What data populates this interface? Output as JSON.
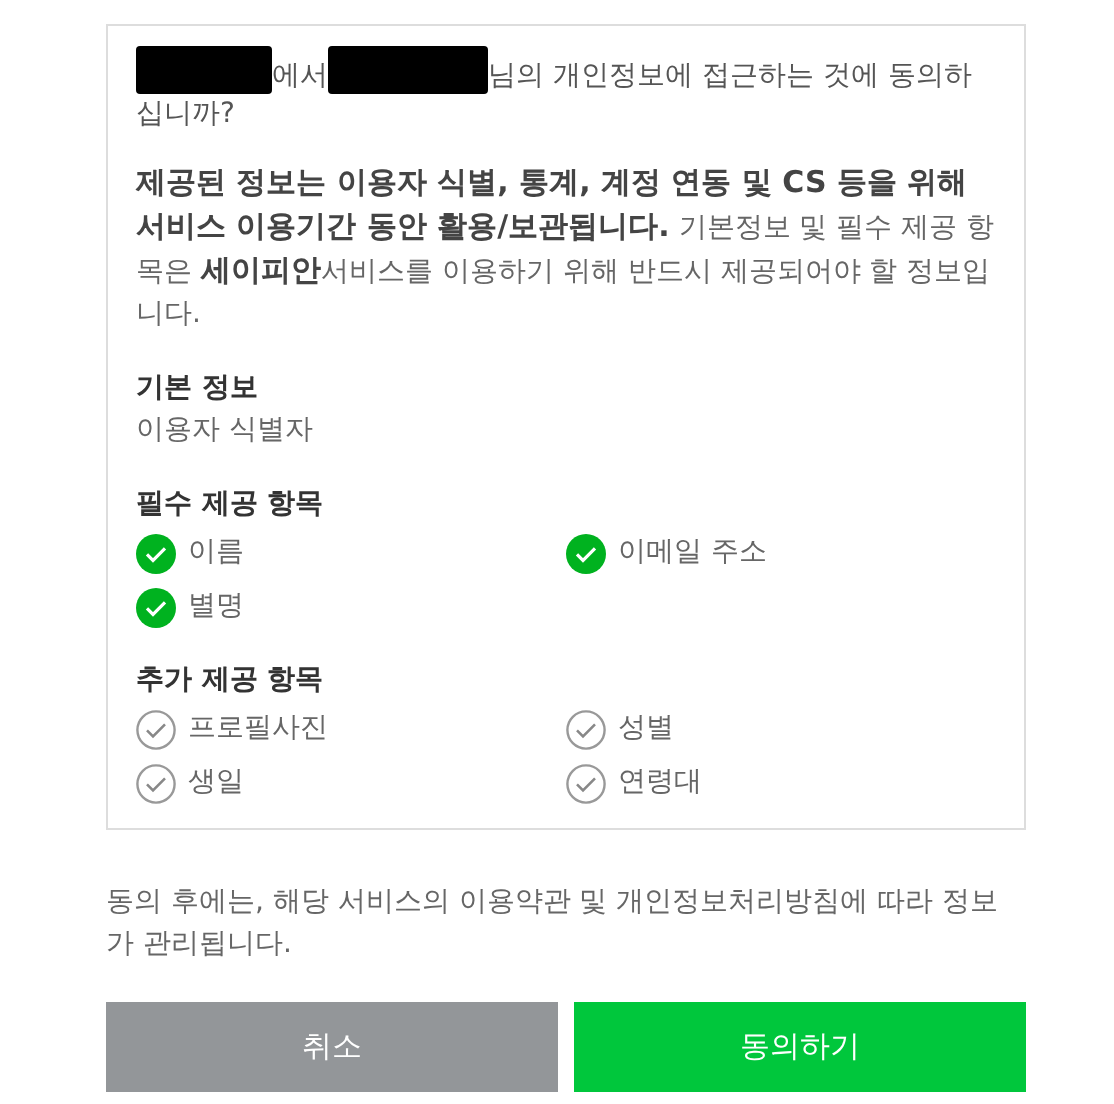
{
  "question": [
    {
      "kind": "redacted"
    },
    {
      "kind": "text",
      "text": "에서"
    },
    {
      "kind": "redacted"
    },
    {
      "kind": "text",
      "text": "님의 개인정보에 접근하는 것에 동의하십니까?"
    }
  ],
  "purpose": "**제공된 정보는 이용자 식별, 통계, 계정 연동 및 CS 등을 위해 서비스 이용기간 동안 활용/보관됩니다.** 기본정보 및 필수 제공 항목은 **세이피안**서비스를 이용하기 위해 반드시 제공되어야 할 정보입니다.",
  "sections": [
    {
      "title": "기본 정보",
      "kind": "text",
      "text": "이용자 식별자"
    },
    {
      "title": "필수 제공 항목",
      "kind": "items",
      "items": [
        {
          "label": "이름",
          "checked": true
        },
        {
          "label": "이메일 주소",
          "checked": true
        },
        {
          "label": "별명",
          "checked": true
        }
      ]
    },
    {
      "title": "추가 제공 항목",
      "kind": "items",
      "items": [
        {
          "label": "프로필사진",
          "checked": false
        },
        {
          "label": "성별",
          "checked": false
        },
        {
          "label": "생일",
          "checked": false
        },
        {
          "label": "연령대",
          "checked": false
        }
      ]
    }
  ],
  "notice": "동의 후에는, 해당 서비스의 이용약관 및 개인정보처리방침에 따라 정보가 관리됩니다.",
  "buttons": [
    {
      "label": "취소",
      "kind": "secondary"
    },
    {
      "label": "동의하기",
      "kind": "primary"
    }
  ]
}
